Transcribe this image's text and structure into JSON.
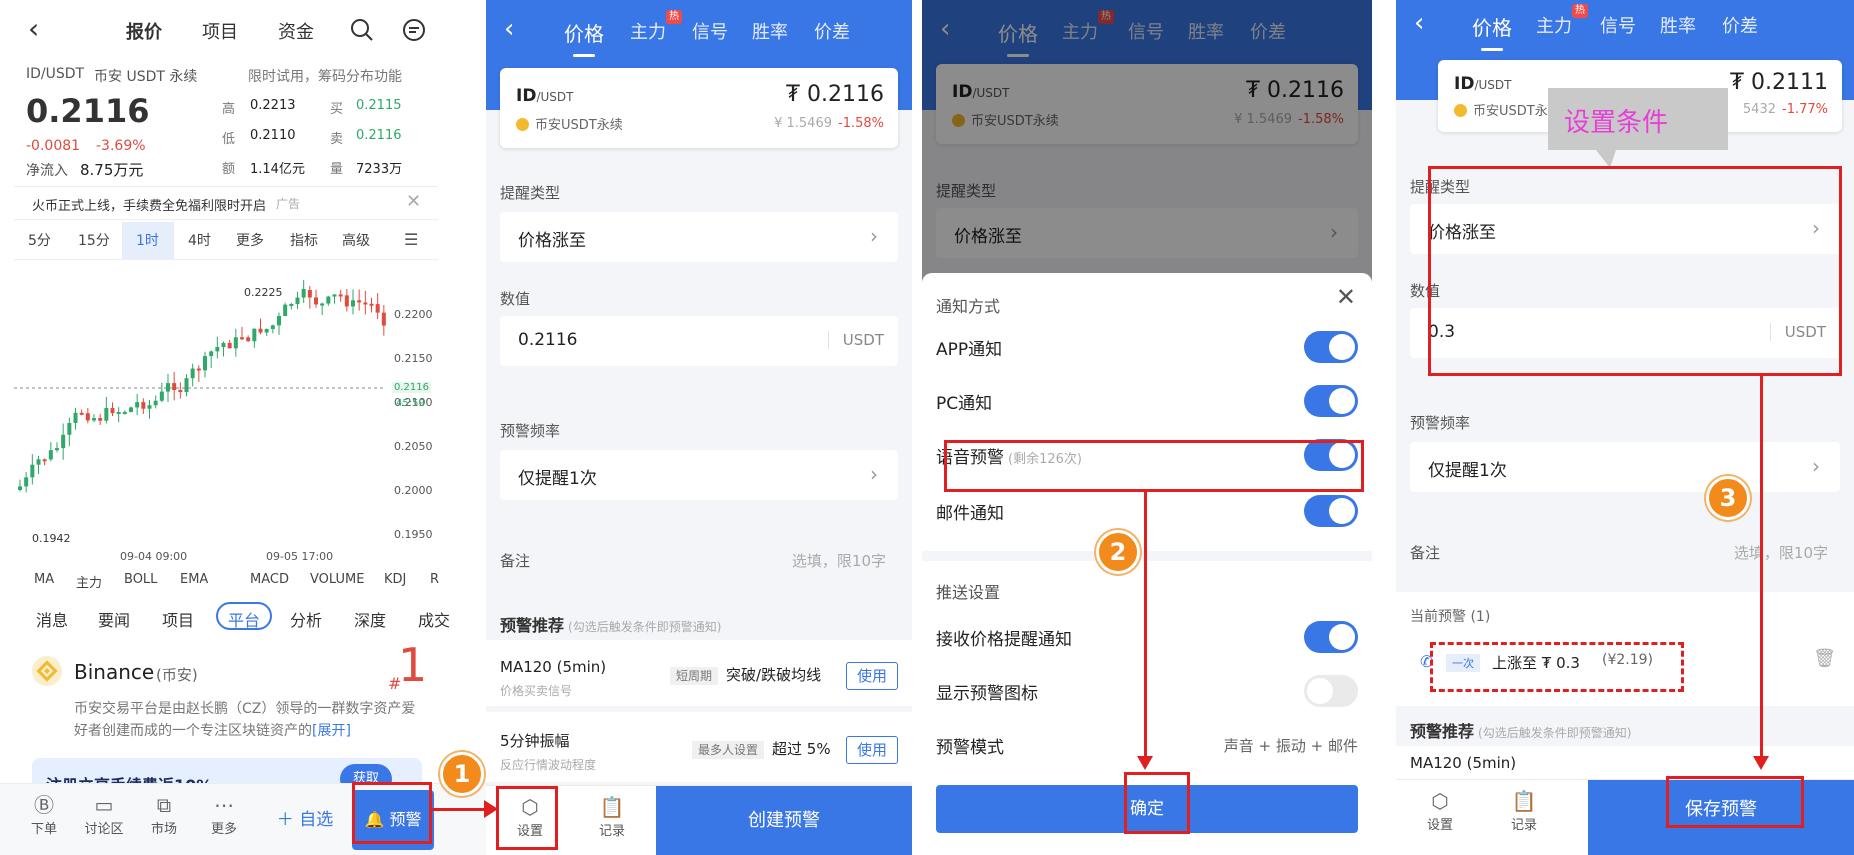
{
  "p1": {
    "nav": {
      "back": "‹",
      "tabs": [
        "报价",
        "项目",
        "资金"
      ]
    },
    "pair": "ID/USDT",
    "exchange_label": "币安 USDT 永续",
    "promo": "限时试用，筹码分布功能",
    "price": "0.2116",
    "change": "-0.0081",
    "change_pct": "-3.69%",
    "inflow_label": "净流入",
    "inflow_value": "8.75万元",
    "stats": {
      "high_label": "高",
      "high": "0.2213",
      "buy_label": "买",
      "buy": "0.2115",
      "low_label": "低",
      "low": "0.2110",
      "sell_label": "卖",
      "sell": "0.2116",
      "amount_label": "额",
      "amount": "1.14亿元",
      "vol_label": "量",
      "vol": "7233万"
    },
    "ad_text": "火币正式上线，手续费全免福利限时开启",
    "ad_tag": "广告",
    "timeframes": [
      "5分",
      "15分",
      "1时",
      "4时",
      "更多",
      "指标",
      "高级"
    ],
    "active_tf": "1时",
    "chart_labels": {
      "high": "0.2225",
      "low": "0.1942",
      "x1": "09-04 09:00",
      "x2": "09-05 17:00",
      "price_tag": "0.2116",
      "countdown": "45:59"
    },
    "y_ticks": [
      "0.2200",
      "0.2150",
      "0.2100",
      "0.2050",
      "0.2000",
      "0.1950"
    ],
    "indicators": [
      "MA",
      "主力",
      "BOLL",
      "EMA",
      "MACD",
      "VOLUME",
      "KDJ",
      "R"
    ],
    "news_tabs": [
      "消息",
      "要闻",
      "项目",
      "平台",
      "分析",
      "深度",
      "成交"
    ],
    "active_news": "平台",
    "binance": {
      "name": "Binance",
      "cn": "(币安)",
      "rank_prefix": "#",
      "rank": "1",
      "desc": "币安交易平台是由赵长鹏（CZ）领导的一群数字资产爱好者创建而成的一个专注区块链资产的",
      "expand": "[展开]"
    },
    "banner": "注册立享手续费返10%",
    "banner_btn": "获取",
    "bottom": [
      "下单",
      "讨论区",
      "市场",
      "更多"
    ],
    "watch_btn": "自选",
    "alert_btn": "预警"
  },
  "alert": {
    "tabs": [
      "价格",
      "主力",
      "信号",
      "胜率",
      "价差"
    ],
    "hot": "热",
    "pair": "ID",
    "quote": "/USDT",
    "exchange": "币安USDT永续",
    "price": "₮ 0.2116",
    "cny": "¥ 1.5469",
    "pct": "-1.58%",
    "type_label": "提醒类型",
    "type_value": "价格涨至",
    "value_label": "数值",
    "value": "0.2116",
    "unit": "USDT",
    "freq_label": "预警频率",
    "freq_value": "仅提醒1次",
    "note_label": "备注",
    "note_placeholder": "选填，限10字",
    "rec_label": "预警推荐",
    "rec_hint": "(勾选后触发条件即预警通知)",
    "rec1_name": "MA120 (5min)",
    "rec1_sub": "价格买卖信号",
    "rec1_tag": "短周期",
    "rec1_desc": "突破/跌破均线",
    "rec2_name": "5分钟振幅",
    "rec2_sub": "反应行情波动程度",
    "rec2_tag": "最多人设置",
    "rec2_desc": "超过 5%",
    "use": "使用",
    "settings": "设置",
    "records": "记录",
    "create": "创建预警"
  },
  "sheet": {
    "notify_title": "通知方式",
    "rows": [
      {
        "label": "APP通知",
        "extra": "",
        "on": true
      },
      {
        "label": "PC通知",
        "extra": "",
        "on": true
      },
      {
        "label": "语音预警",
        "extra": "(剩余126次)",
        "on": true
      },
      {
        "label": "邮件通知",
        "extra": "",
        "on": true
      }
    ],
    "push_title": "推送设置",
    "push_rows": [
      {
        "label": "接收价格提醒通知",
        "on": true
      },
      {
        "label": "显示预警图标",
        "on": false
      }
    ],
    "mode_label": "预警模式",
    "mode_value": "声音 + 振动 + 邮件",
    "confirm": "确定"
  },
  "p4": {
    "price": "₮ 0.2111",
    "cny": "5432",
    "pct": "-1.77%",
    "callout": "设置条件",
    "value": "0.3",
    "current_label": "当前预警 (1)",
    "current_tag": "一次",
    "current_text": "上涨至 ₮ 0.3",
    "current_cny": "(¥2.19)",
    "save": "保存预警"
  },
  "steps": [
    "1",
    "2",
    "3"
  ]
}
